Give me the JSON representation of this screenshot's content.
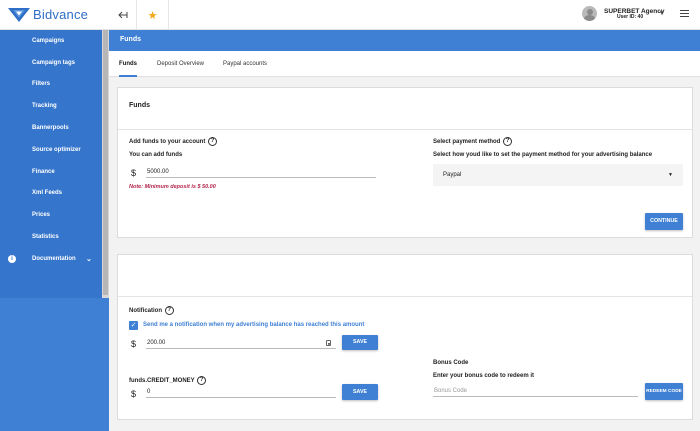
{
  "brand": {
    "name": "Bidvance",
    "color": "#3f80d4"
  },
  "sidebar": {
    "items": [
      {
        "label": "Campaigns"
      },
      {
        "label": "Campaign tags"
      },
      {
        "label": "Filters"
      },
      {
        "label": "Tracking"
      },
      {
        "label": "Bannerpools"
      },
      {
        "label": "Source optimizer"
      },
      {
        "label": "Finance",
        "active": true
      },
      {
        "label": "Xml Feeds"
      },
      {
        "label": "Prices"
      },
      {
        "label": "Statistics"
      },
      {
        "label": "Documentation",
        "icon": "info-icon",
        "expandable": true
      }
    ]
  },
  "topbar": {
    "collapse_icon": "arrow-left-collapse-icon",
    "favorite_icon": "star-icon",
    "user": {
      "name": "SUPERBET Agency",
      "id_label": "User ID: 40"
    },
    "menu_icon": "hamburger-icon"
  },
  "page": {
    "title": "Funds"
  },
  "tabs": [
    {
      "label": "Funds",
      "active": true
    },
    {
      "label": "Deposit Overview"
    },
    {
      "label": "Paypal accounts"
    }
  ],
  "funds_card": {
    "title": "Funds",
    "add_funds": {
      "label": "Add funds to your account",
      "sublabel": "You can add funds",
      "currency": "$",
      "value": "5000.00",
      "note": "Note: Minimum deposit is $ 50.00"
    },
    "payment": {
      "label": "Select payment method",
      "sublabel": "Select how youd like to set the payment method for your advertising balance",
      "selected": "Paypal"
    },
    "continue_label": "CONTINUE"
  },
  "notification_card": {
    "label": "Notification",
    "checkbox_label": "Send me a notification when my advertising balance has reached this amount",
    "checked": true,
    "currency": "$",
    "value": "200.00",
    "save_label": "SAVE",
    "credit": {
      "label": "funds.CREDIT_MONEY",
      "currency": "$",
      "value": "0",
      "save_label": "SAVE"
    },
    "bonus": {
      "label": "Bonus Code",
      "sublabel": "Enter your bonus code to redeem it",
      "placeholder": "Bonus Code",
      "redeem_label": "REDEEM CODE"
    }
  }
}
